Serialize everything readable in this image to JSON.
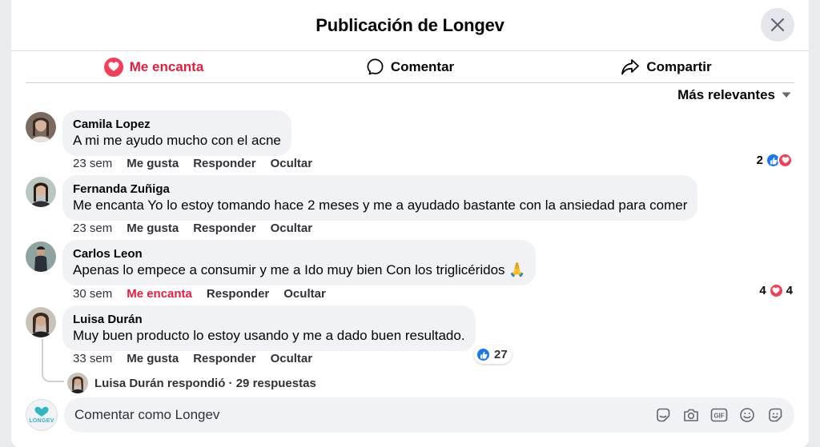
{
  "header": {
    "title": "Publicación de Longev"
  },
  "actions": {
    "love": "Me encanta",
    "comment": "Comentar",
    "share": "Compartir"
  },
  "sort": {
    "label": "Más relevantes"
  },
  "comments": [
    {
      "author": "Camila Lopez",
      "text": "A mi me ayudo mucho con el acne",
      "time": "23 sem",
      "reaction": "Me gusta",
      "reply": "Responder",
      "hide": "Ocultar",
      "reaction_count": "2"
    },
    {
      "author": "Fernanda Zuñiga",
      "text": "Me encanta Yo lo estoy tomando hace 2 meses y me a ayudado bastante con la ansiedad para comer",
      "time": "23 sem",
      "reaction": "Me gusta",
      "reply": "Responder",
      "hide": "Ocultar"
    },
    {
      "author": "Carlos Leon",
      "text": "Apenas lo empece a consumir y me a Ido muy bien Con los triglicéridos 🙏",
      "time": "30 sem",
      "reaction": "Me encanta",
      "reply": "Responder",
      "hide": "Ocultar",
      "reaction_count_left": "4",
      "reaction_count_right": "4"
    },
    {
      "author": "Luisa Durán",
      "text": "Muy buen producto lo estoy usando y me a dado buen resultado.",
      "time": "33 sem",
      "reaction": "Me gusta",
      "reply": "Responder",
      "hide": "Ocultar",
      "reaction_count": "27",
      "reply_author": "Luisa Durán",
      "reply_verb": "respondió",
      "reply_sep": "·",
      "reply_count": "29 respuestas"
    }
  ],
  "composer": {
    "placeholder": "Comentar como Longev",
    "logo_text": "LONGEV",
    "tools": [
      "sticker-icon",
      "camera-icon",
      "gif-icon",
      "emoji-icon",
      "avatar-sticker-icon"
    ]
  },
  "colors": {
    "accent": "#e41e3f",
    "like": "#1877f2",
    "heart": "#f33e58",
    "bubble": "#f0f2f5",
    "logo": "#2fb6c6"
  }
}
